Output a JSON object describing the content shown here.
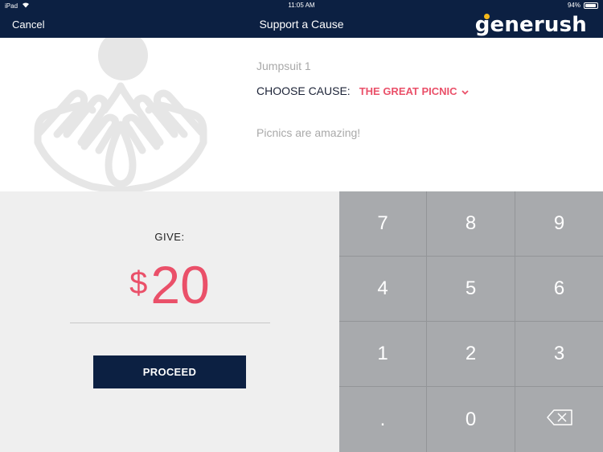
{
  "status_bar": {
    "device": "iPad",
    "time": "11:05 AM",
    "battery": "94%"
  },
  "nav": {
    "cancel_label": "Cancel",
    "title": "Support a Cause",
    "logo_text": "generush"
  },
  "cause": {
    "item_name": "Jumpsuit 1",
    "choose_label": "CHOOSE CAUSE:",
    "selected_cause": "THE GREAT PICNIC",
    "description": "Picnics are amazing!"
  },
  "give": {
    "label": "GIVE:",
    "currency": "$",
    "amount": "20",
    "proceed_label": "PROCEED"
  },
  "keypad": {
    "keys": [
      "7",
      "8",
      "9",
      "4",
      "5",
      "6",
      "1",
      "2",
      "3",
      ".",
      "0"
    ],
    "delete_icon": "backspace-icon"
  },
  "colors": {
    "nav_background": "#0c2042",
    "accent": "#ea5069",
    "logo_dot": "#f5b91a",
    "keypad": "#a8aaad",
    "panel": "#efefef"
  }
}
